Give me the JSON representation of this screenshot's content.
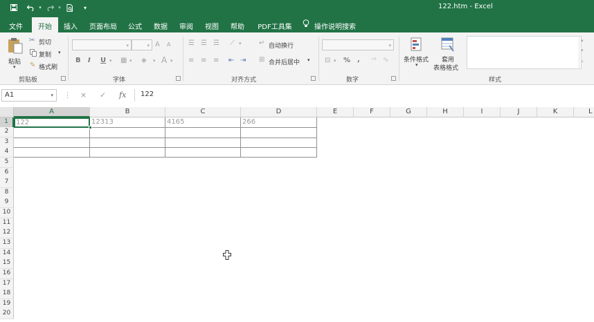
{
  "title_bar": {
    "document_title": "122.htm  -  Excel",
    "quick_access": [
      "save-icon",
      "undo-icon",
      "redo-icon",
      "print-preview-icon",
      "customize-icon"
    ]
  },
  "ribbon_tabs": [
    {
      "label": "文件"
    },
    {
      "label": "开始",
      "active": true
    },
    {
      "label": "插入"
    },
    {
      "label": "页面布局"
    },
    {
      "label": "公式"
    },
    {
      "label": "数据"
    },
    {
      "label": "审阅"
    },
    {
      "label": "视图"
    },
    {
      "label": "帮助"
    },
    {
      "label": "PDF工具集"
    },
    {
      "label": "操作说明搜索"
    }
  ],
  "ribbon": {
    "clipboard": {
      "paste": "粘贴",
      "cut": "剪切",
      "copy": "复制",
      "format_painter": "格式刷",
      "group": "剪贴板"
    },
    "font": {
      "group": "字体",
      "bold": "B",
      "italic": "I",
      "underline": "U",
      "grow": "A",
      "shrink": "A",
      "font_color": "A"
    },
    "alignment": {
      "group": "对齐方式",
      "wrap": "自动换行",
      "merge": "合并后居中"
    },
    "number": {
      "group": "数字",
      "percent": "%",
      "comma": ","
    },
    "styles": {
      "group": "样式",
      "conditional": "条件格式",
      "table_line1": "套用",
      "table_line2": "表格格式"
    }
  },
  "formula_bar": {
    "name_box": "A1",
    "cancel": "×",
    "enter": "✓",
    "fx": "fx",
    "value": "122"
  },
  "sheet": {
    "columns": [
      "A",
      "B",
      "C",
      "D",
      "E",
      "F",
      "G",
      "H",
      "I",
      "J",
      "K",
      "L"
    ],
    "rows": [
      "1",
      "2",
      "3",
      "4",
      "5",
      "6",
      "7",
      "8",
      "9",
      "10",
      "11",
      "12",
      "13",
      "14",
      "15",
      "16",
      "17",
      "18",
      "19",
      "20"
    ],
    "cells": {
      "A1": "122",
      "B1": "12313",
      "C1": "4165",
      "D1": "266"
    },
    "active_cell": "A1"
  },
  "colors": {
    "accent": "#217346",
    "ribbon_bg": "#f3f3f3"
  }
}
